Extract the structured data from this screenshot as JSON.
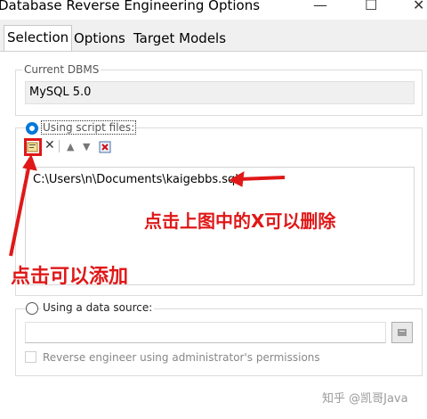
{
  "window": {
    "title": "Database Reverse Engineering Options",
    "minimize_glyph": "—",
    "maximize_glyph": "☐",
    "close_glyph": "✕"
  },
  "tabs": [
    {
      "label": "Selection",
      "active": true
    },
    {
      "label": "Options",
      "active": false
    },
    {
      "label": "Target Models",
      "active": false
    }
  ],
  "current_dbms": {
    "label": "Current DBMS",
    "value": "MySQL 5.0"
  },
  "script_files": {
    "radio_label": "Using script files:",
    "selected": true,
    "toolbar": {
      "add_icon": "add-files-icon",
      "delete_icon": "delete-x-icon",
      "move_up_icon": "move-up-icon",
      "move_down_icon": "move-down-icon",
      "clear_icon": "clear-list-icon"
    },
    "files": [
      "C:\\Users\\n\\Documents\\kaigebbs.sql"
    ]
  },
  "data_source": {
    "radio_label": "Using a data source:",
    "selected": false,
    "value": "",
    "browse_icon": "datasource-browse-icon",
    "admin_checkbox_label": "Reverse engineer using administrator's permissions",
    "admin_checked": false
  },
  "annotations": {
    "delete_hint": "点击上图中的X可以删除",
    "add_hint": "点击可以添加",
    "color": "#e01818"
  },
  "watermark": "知乎 @凯哥Java"
}
